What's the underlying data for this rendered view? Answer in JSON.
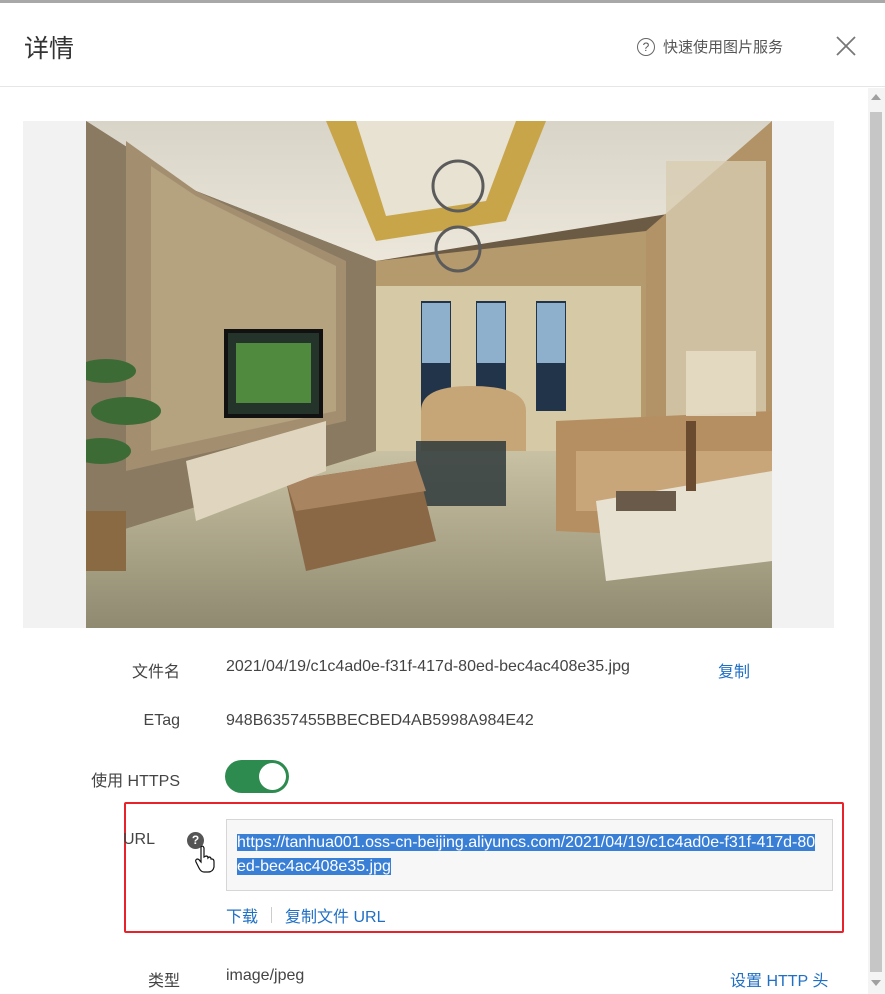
{
  "header": {
    "title": "详情",
    "help_icon": "?",
    "help_label": "快速使用图片服务"
  },
  "details": {
    "filename_label": "文件名",
    "filename_value": "2021/04/19/c1c4ad0e-f31f-417d-80ed-bec4ac408e35.jpg",
    "copy_label": "复制",
    "etag_label": "ETag",
    "etag_value": "948B6357455BBECBED4AB5998A984E42",
    "https_label": "使用 HTTPS",
    "https_enabled": true,
    "url_label": "URL",
    "url_help_icon": "?",
    "url_value": "https://tanhua001.oss-cn-beijing.aliyuncs.com/2021/04/19/c1c4ad0e-f31f-417d-80ed-bec4ac408e35.jpg",
    "download_label": "下载",
    "copy_url_label": "复制文件 URL",
    "type_label": "类型",
    "type_value": "image/jpeg",
    "set_http_header_label": "设置 HTTP 头"
  },
  "colors": {
    "link": "#1f6fc4",
    "toggle_on": "#2e8b4f",
    "highlight": "#e8222b",
    "selection": "#3a7fd6"
  }
}
